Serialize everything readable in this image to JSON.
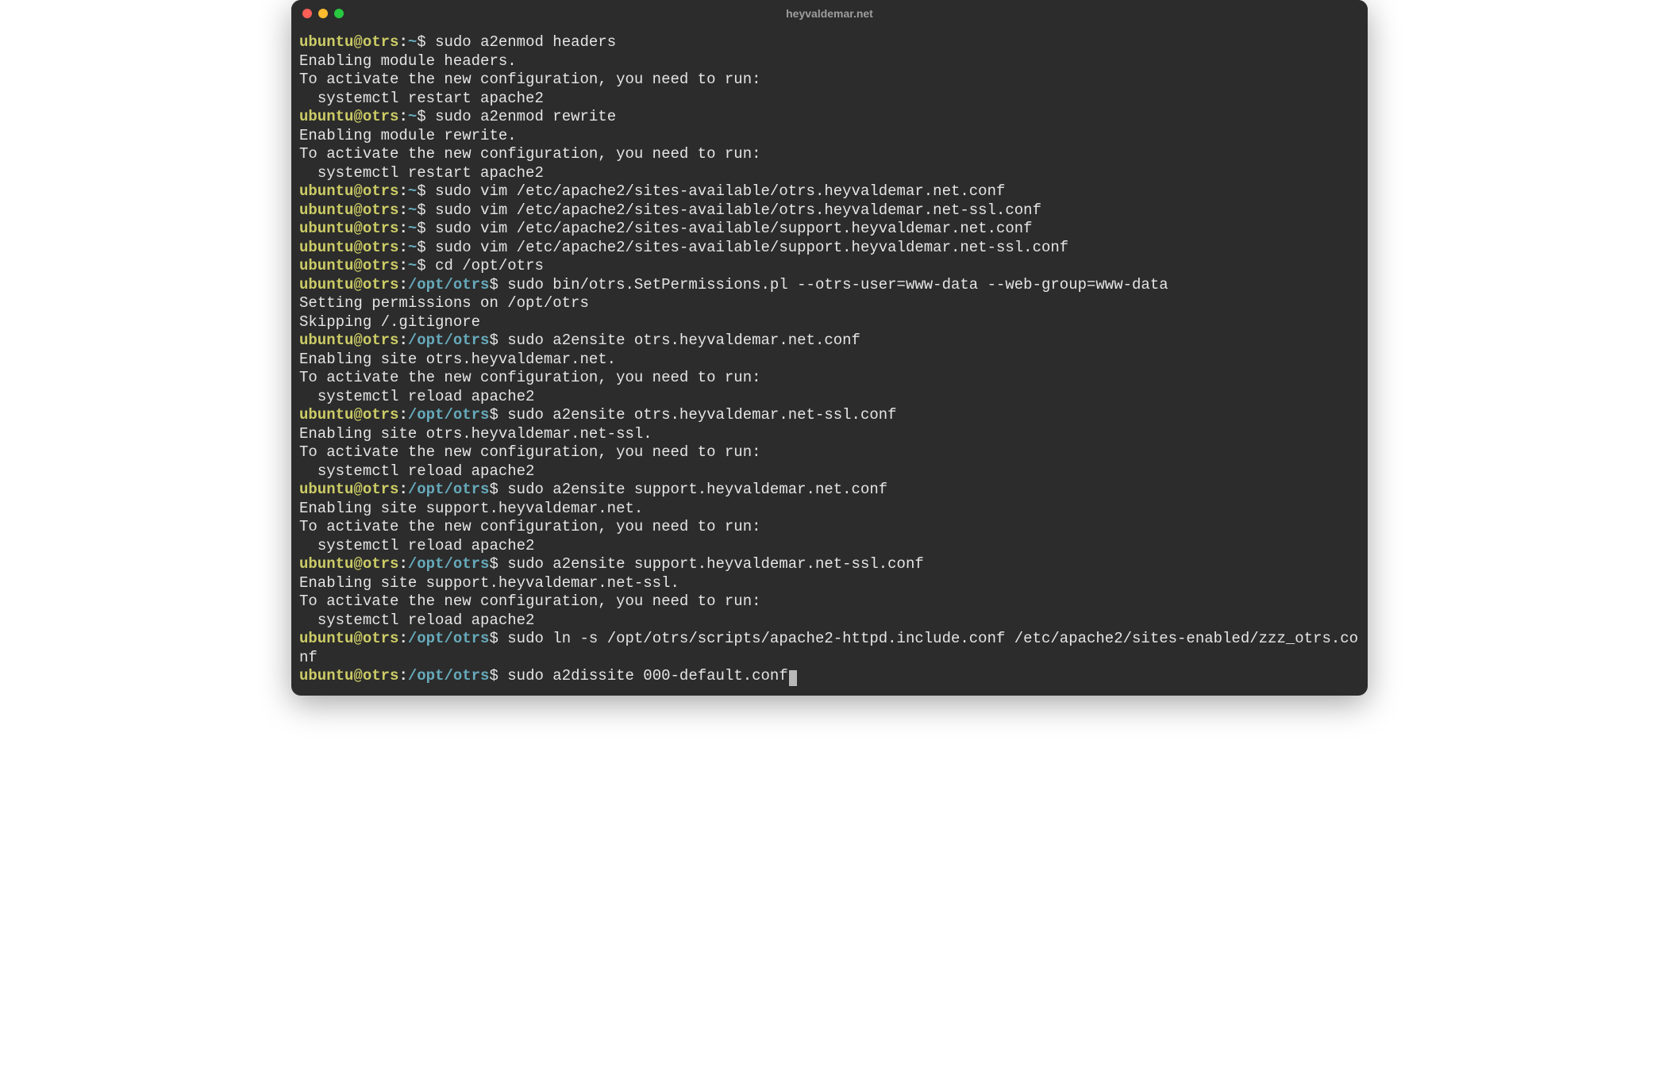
{
  "window": {
    "title": "heyvaldemar.net"
  },
  "prompt": {
    "user": "ubuntu",
    "host": "otrs",
    "home_path": "~",
    "cwd_path": "/opt/otrs"
  },
  "lines": [
    {
      "type": "prompt",
      "cwd": "home",
      "cmd": "sudo a2enmod headers"
    },
    {
      "type": "output",
      "text": "Enabling module headers."
    },
    {
      "type": "output",
      "text": "To activate the new configuration, you need to run:"
    },
    {
      "type": "output",
      "text": "  systemctl restart apache2"
    },
    {
      "type": "prompt",
      "cwd": "home",
      "cmd": "sudo a2enmod rewrite"
    },
    {
      "type": "output",
      "text": "Enabling module rewrite."
    },
    {
      "type": "output",
      "text": "To activate the new configuration, you need to run:"
    },
    {
      "type": "output",
      "text": "  systemctl restart apache2"
    },
    {
      "type": "prompt",
      "cwd": "home",
      "cmd": "sudo vim /etc/apache2/sites-available/otrs.heyvaldemar.net.conf"
    },
    {
      "type": "prompt",
      "cwd": "home",
      "cmd": "sudo vim /etc/apache2/sites-available/otrs.heyvaldemar.net-ssl.conf"
    },
    {
      "type": "prompt",
      "cwd": "home",
      "cmd": "sudo vim /etc/apache2/sites-available/support.heyvaldemar.net.conf"
    },
    {
      "type": "prompt",
      "cwd": "home",
      "cmd": "sudo vim /etc/apache2/sites-available/support.heyvaldemar.net-ssl.conf"
    },
    {
      "type": "prompt",
      "cwd": "home",
      "cmd": "cd /opt/otrs"
    },
    {
      "type": "prompt",
      "cwd": "path",
      "cmd": "sudo bin/otrs.SetPermissions.pl --otrs-user=www-data --web-group=www-data"
    },
    {
      "type": "output",
      "text": "Setting permissions on /opt/otrs"
    },
    {
      "type": "output",
      "text": "Skipping /.gitignore"
    },
    {
      "type": "prompt",
      "cwd": "path",
      "cmd": "sudo a2ensite otrs.heyvaldemar.net.conf"
    },
    {
      "type": "output",
      "text": "Enabling site otrs.heyvaldemar.net."
    },
    {
      "type": "output",
      "text": "To activate the new configuration, you need to run:"
    },
    {
      "type": "output",
      "text": "  systemctl reload apache2"
    },
    {
      "type": "prompt",
      "cwd": "path",
      "cmd": "sudo a2ensite otrs.heyvaldemar.net-ssl.conf"
    },
    {
      "type": "output",
      "text": "Enabling site otrs.heyvaldemar.net-ssl."
    },
    {
      "type": "output",
      "text": "To activate the new configuration, you need to run:"
    },
    {
      "type": "output",
      "text": "  systemctl reload apache2"
    },
    {
      "type": "prompt",
      "cwd": "path",
      "cmd": "sudo a2ensite support.heyvaldemar.net.conf"
    },
    {
      "type": "output",
      "text": "Enabling site support.heyvaldemar.net."
    },
    {
      "type": "output",
      "text": "To activate the new configuration, you need to run:"
    },
    {
      "type": "output",
      "text": "  systemctl reload apache2"
    },
    {
      "type": "prompt",
      "cwd": "path",
      "cmd": "sudo a2ensite support.heyvaldemar.net-ssl.conf"
    },
    {
      "type": "output",
      "text": "Enabling site support.heyvaldemar.net-ssl."
    },
    {
      "type": "output",
      "text": "To activate the new configuration, you need to run:"
    },
    {
      "type": "output",
      "text": "  systemctl reload apache2"
    },
    {
      "type": "prompt",
      "cwd": "path",
      "cmd": "sudo ln -s /opt/otrs/scripts/apache2-httpd.include.conf /etc/apache2/sites-enabled/zzz_otrs.conf"
    },
    {
      "type": "prompt",
      "cwd": "path",
      "cmd": "sudo a2dissite 000-default.conf",
      "cursor": true
    }
  ]
}
